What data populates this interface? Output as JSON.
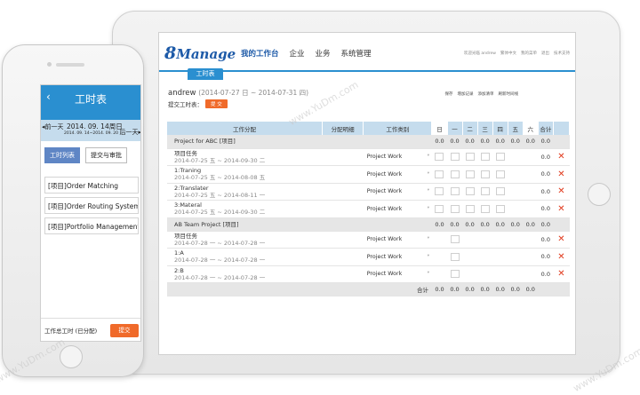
{
  "tablet": {
    "logo": {
      "prefix": "8",
      "word": "Manage"
    },
    "nav": [
      "我的工作台",
      "企业",
      "业务",
      "系统管理"
    ],
    "toplinks": [
      "欢迎光临 andrew",
      "繁体中文",
      "我的菜单",
      "退出",
      "技术支持"
    ],
    "subtab": "工时表",
    "user": "andrew",
    "period": "(2014-07-27 日 ~ 2014-07-31 四)",
    "submit_label": "提交工时表：",
    "submit_button": "提 交",
    "actions": [
      "保存",
      "增加记录",
      "添加清单",
      "刷新时间线"
    ],
    "headers": {
      "assign": "工作分配",
      "detail": "分配明细",
      "type": "工作类别",
      "days": [
        "日",
        "一",
        "二",
        "三",
        "四",
        "五",
        "六"
      ],
      "total": "合计"
    },
    "rows": [
      {
        "kind": "project",
        "name": "Project for ABC [项目]",
        "values": [
          "0.0",
          "0.0",
          "0.0",
          "0.0",
          "0.0",
          "0.0",
          "0.0"
        ],
        "total": "0.0"
      },
      {
        "kind": "task",
        "name": "项目任务",
        "date": "2014-07-25 五 ~ 2014-09-30 二",
        "type": "Project Work",
        "total": "0.0"
      },
      {
        "kind": "task",
        "name": "1:Traning",
        "date": "2014-07-25 五 ~ 2014-08-08 五",
        "type": "Project Work",
        "total": "0.0"
      },
      {
        "kind": "task",
        "name": "2:Translater",
        "date": "2014-07-25 五 ~ 2014-08-11 一",
        "type": "Project Work",
        "total": "0.0"
      },
      {
        "kind": "task",
        "name": "3:Materal",
        "date": "2014-07-25 五 ~ 2014-09-30 二",
        "type": "Project Work",
        "total": "0.0"
      },
      {
        "kind": "project",
        "name": "AB Team Project [项目]",
        "values": [
          "0.0",
          "0.0",
          "0.0",
          "0.0",
          "0.0",
          "0.0",
          "0.0"
        ],
        "total": "0.0"
      },
      {
        "kind": "task",
        "name": "项目任务",
        "date": "2014-07-28 一 ~ 2014-07-28 一",
        "type": "Project Work",
        "total": "0.0"
      },
      {
        "kind": "task",
        "name": "1:A",
        "date": "2014-07-28 一 ~ 2014-07-28 一",
        "type": "Project Work",
        "total": "0.0"
      },
      {
        "kind": "task",
        "name": "2:B",
        "date": "2014-07-28 一 ~ 2014-07-28 一",
        "type": "Project Work",
        "total": "0.0"
      }
    ],
    "totals": {
      "label": "合计",
      "values": [
        "0.0",
        "0.0",
        "0.0",
        "0.0",
        "0.0",
        "0.0",
        "0.0"
      ]
    },
    "delete_glyph": "✕"
  },
  "phone": {
    "title": "工时表",
    "back": "‹",
    "prev": "◂前一天",
    "next": "后一天▸",
    "day": "2014. 09. 14周日",
    "range": "2014. 09. 14~2014. 09. 20",
    "tabs": [
      "工时列表",
      "提交与审批"
    ],
    "items": [
      "[项目]Order Matching",
      "[项目]Order Routing System",
      "[项目]Portfolio Management..."
    ],
    "footer_label": "工作总工时 (已分配)",
    "footer_button": "提交"
  },
  "watermark": "www.YuDm.com"
}
